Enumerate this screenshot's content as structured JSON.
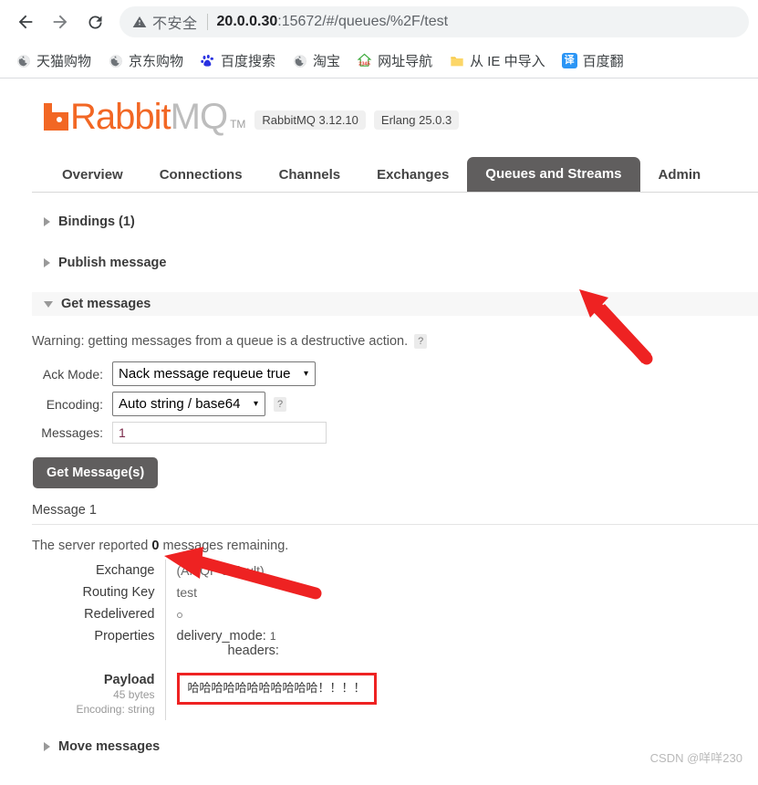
{
  "browser": {
    "back_icon": "back-arrow-icon",
    "forward_icon": "forward-arrow-icon",
    "reload_icon": "reload-icon",
    "security_warning": "不安全",
    "url_host": "20.0.0.30",
    "url_rest": ":15672/#/queues/%2F/test",
    "url_full": "20.0.0.30:15672/#/queues/%2F/test",
    "bookmarks": [
      {
        "label": "天猫购物",
        "icon": "globe-icon"
      },
      {
        "label": "京东购物",
        "icon": "globe-icon"
      },
      {
        "label": "百度搜索",
        "icon": "baidu-icon"
      },
      {
        "label": "淘宝",
        "icon": "globe-icon"
      },
      {
        "label": "网址导航",
        "icon": "2345-icon"
      },
      {
        "label": "从 IE 中导入",
        "icon": "folder-icon"
      },
      {
        "label": "百度翻",
        "icon": "fanyi-icon"
      }
    ]
  },
  "header": {
    "logo_rabbit": "Rabbit",
    "logo_mq": "MQ",
    "logo_tm": "TM",
    "badges": [
      "RabbitMQ 3.12.10",
      "Erlang 25.0.3"
    ]
  },
  "tabs": [
    {
      "label": "Overview",
      "active": false
    },
    {
      "label": "Connections",
      "active": false
    },
    {
      "label": "Channels",
      "active": false
    },
    {
      "label": "Exchanges",
      "active": false
    },
    {
      "label": "Queues and Streams",
      "active": true
    },
    {
      "label": "Admin",
      "active": false
    }
  ],
  "sections": {
    "bindings": "Bindings (1)",
    "publish_message": "Publish message",
    "get_messages": "Get messages",
    "move_messages": "Move messages"
  },
  "get_messages": {
    "warning": "Warning: getting messages from a queue is a destructive action.",
    "warning_help": "?",
    "ack_mode_label": "Ack Mode:",
    "ack_mode_value": "Nack message requeue true",
    "encoding_label": "Encoding:",
    "encoding_value": "Auto string / base64",
    "encoding_help": "?",
    "messages_label": "Messages:",
    "messages_value": "1",
    "get_button": "Get Message(s)"
  },
  "message": {
    "title": "Message 1",
    "server_reported_prefix": "The server reported ",
    "server_reported_count": "0",
    "server_reported_suffix": " messages remaining.",
    "rows": {
      "exchange_label": "Exchange",
      "exchange_value": "(AMQP default)",
      "routing_key_label": "Routing Key",
      "routing_key_value": "test",
      "redelivered_label": "Redelivered",
      "redelivered_value": "○",
      "properties_label": "Properties",
      "property_delivery_mode_key": "delivery_mode:",
      "property_delivery_mode_value": "1",
      "property_headers_key": "headers:",
      "payload_label": "Payload",
      "payload_size": "45 bytes",
      "payload_encoding": "Encoding: string",
      "payload_value": "哈哈哈哈哈哈哈哈哈哈哈！！！！"
    }
  },
  "annotations": {
    "arrow_color": "#ee2222",
    "highlight_color": "#ee2222"
  },
  "watermark": "CSDN @咩咩230"
}
